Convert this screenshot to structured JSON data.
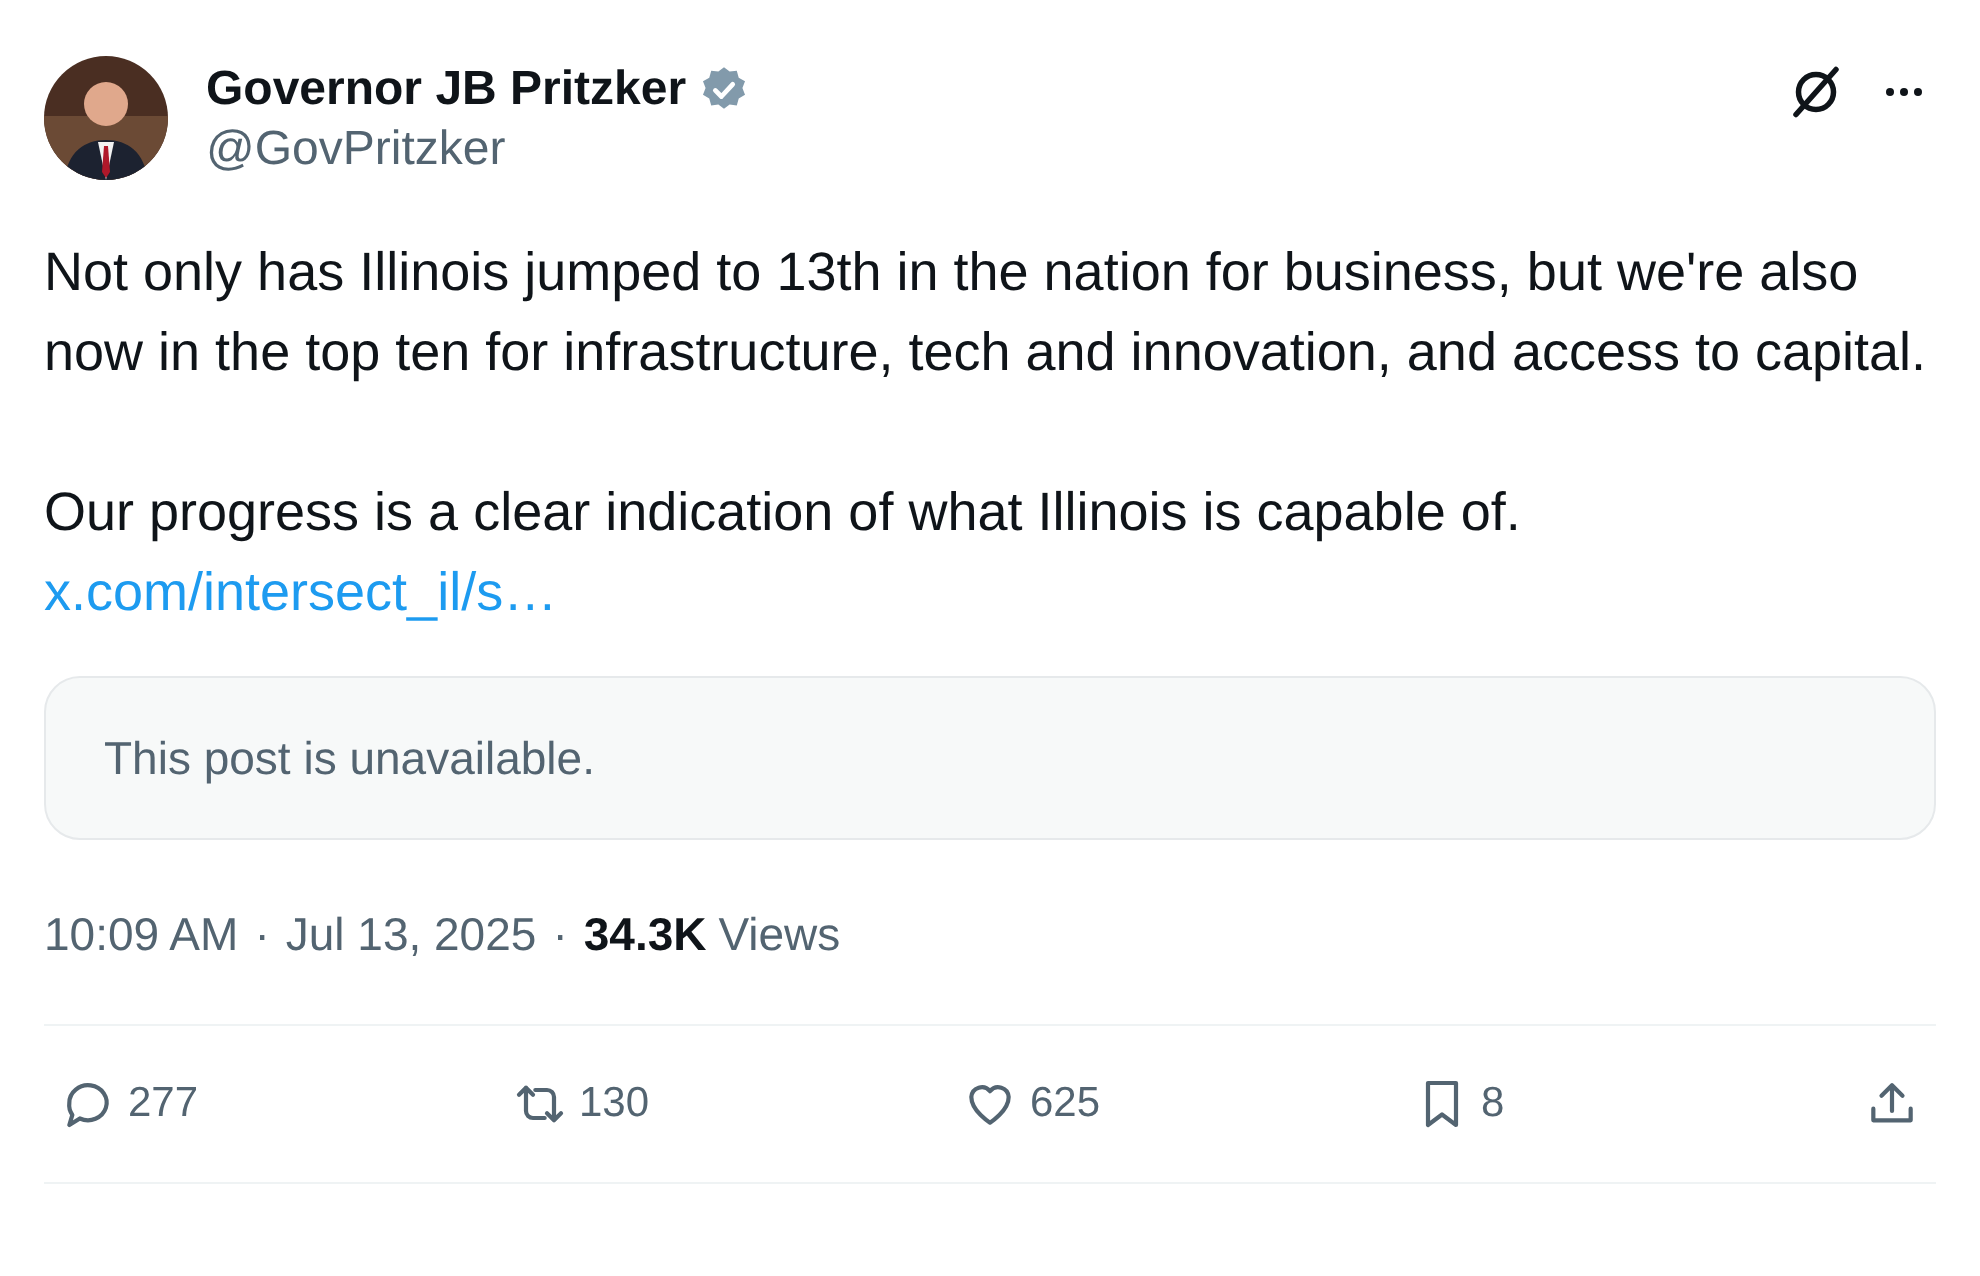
{
  "author": {
    "name": "Governor JB Pritzker",
    "verified": true,
    "handle": "@GovPritzker"
  },
  "header_icons": [
    {
      "kind": "grok"
    },
    {
      "kind": "more"
    }
  ],
  "body": {
    "paragraphs": [
      "Not only has Illinois jumped to 13th in the nation for business, but we're also now in the top ten for infrastructure, tech and innovation, and access to capital.",
      "Our progress is a clear indication of what Illinois is capable of."
    ],
    "link": "x.com/intersect_il/s…"
  },
  "quoted_post": {
    "message": "This post is unavailable."
  },
  "meta": {
    "time": "10:09 AM",
    "separator": "·",
    "date": "Jul 13, 2025",
    "views": "34.3K",
    "views_label": "Views"
  },
  "actions": [
    {
      "kind": "reply",
      "count": "277"
    },
    {
      "kind": "repost",
      "count": "130"
    },
    {
      "kind": "like",
      "count": "625"
    },
    {
      "kind": "bookmark",
      "count": "8"
    },
    {
      "kind": "share"
    }
  ]
}
